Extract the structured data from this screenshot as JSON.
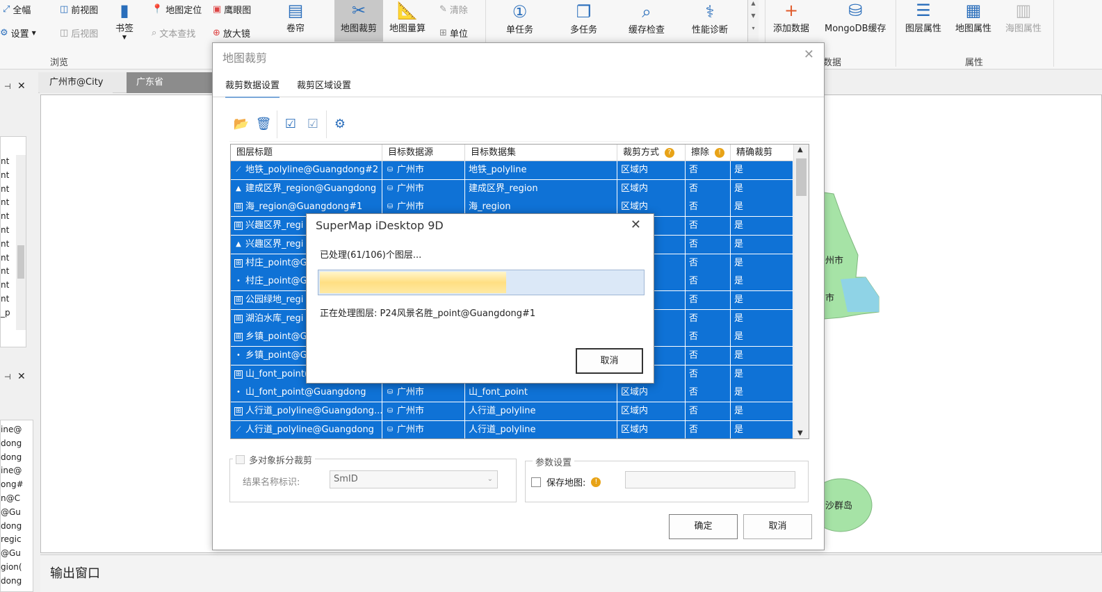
{
  "ribbon": {
    "browse": {
      "full_extent": "全幅",
      "settings": "设置",
      "prev_view": "前视图",
      "next_view": "后视图",
      "bookmark": "书签",
      "locate": "地图定位",
      "text_search": "文本查找",
      "eagle_eye": "鹰眼图",
      "magnifier": "放大镜",
      "group": "浏览"
    },
    "swipe": "卷帘",
    "clip": "地图裁剪",
    "measure": "地图量算",
    "clear": "清除",
    "unit": "单位",
    "tasks": {
      "single": "单任务",
      "multi": "多任务",
      "cache_check": "缓存检查",
      "diagnosis": "性能诊断"
    },
    "data": {
      "add": "添加数据",
      "mongo": "MongoDB缓存",
      "group": "数据"
    },
    "props": {
      "layer": "图层属性",
      "map": "地图属性",
      "chart": "海图属性",
      "group": "属性"
    }
  },
  "map_tabs": [
    "广州市@City",
    "广东省@Guangdong"
  ],
  "left_panel": {
    "items_top": [
      "nt",
      "nt",
      "nt",
      "nt",
      "nt",
      "nt",
      "nt",
      "nt",
      "nt",
      "nt",
      "nt",
      "_p"
    ],
    "items_bottom": [
      "ine@",
      "dong",
      "dong",
      "ine@",
      "ong#",
      "n@C",
      "@Gu",
      "dong",
      "regic",
      "@Gu",
      "gion(",
      "dong"
    ]
  },
  "map_labels": {
    "city": "州市",
    "city2": "市",
    "island": "沙群岛"
  },
  "output": {
    "title": "输出窗口"
  },
  "dialog": {
    "title": "地图裁剪",
    "tabs": [
      "裁剪数据设置",
      "裁剪区域设置"
    ],
    "columns": [
      "图层标题",
      "目标数据源",
      "目标数据集",
      "裁剪方式",
      "擦除",
      "精确裁剪"
    ],
    "rows": [
      {
        "title": "地铁_polyline@Guangdong#2",
        "src": "广州市",
        "ds": "地铁_polyline",
        "mode": "区域内",
        "erase": "否",
        "exact": "是",
        "icon": "line"
      },
      {
        "title": "建成区界_region@Guangdong",
        "src": "广州市",
        "ds": "建成区界_region",
        "mode": "区域内",
        "erase": "否",
        "exact": "是",
        "icon": "region"
      },
      {
        "title": "海_region@Guangdong#1",
        "src": "广州市",
        "ds": "海_region",
        "mode": "区域内",
        "erase": "否",
        "exact": "是",
        "icon": "theme"
      },
      {
        "title": "兴趣区界_regi",
        "src": "",
        "ds": "",
        "mode": "",
        "erase": "否",
        "exact": "是",
        "icon": "theme"
      },
      {
        "title": "兴趣区界_regi",
        "src": "",
        "ds": "",
        "mode": "",
        "erase": "否",
        "exact": "是",
        "icon": "region"
      },
      {
        "title": "村庄_point@G",
        "src": "",
        "ds": "",
        "mode": "",
        "erase": "否",
        "exact": "是",
        "icon": "theme"
      },
      {
        "title": "村庄_point@G",
        "src": "",
        "ds": "",
        "mode": "",
        "erase": "否",
        "exact": "是",
        "icon": "point"
      },
      {
        "title": "公园绿地_regi",
        "src": "",
        "ds": "",
        "mode": "",
        "erase": "否",
        "exact": "是",
        "icon": "theme"
      },
      {
        "title": "湖泊水库_regi",
        "src": "",
        "ds": "",
        "mode": "",
        "erase": "否",
        "exact": "是",
        "icon": "theme"
      },
      {
        "title": "乡镇_point@G",
        "src": "",
        "ds": "",
        "mode": "",
        "erase": "否",
        "exact": "是",
        "icon": "theme"
      },
      {
        "title": "乡镇_point@G",
        "src": "",
        "ds": "",
        "mode": "",
        "erase": "否",
        "exact": "是",
        "icon": "point"
      },
      {
        "title": "山_font_point(",
        "src": "",
        "ds": "",
        "mode": "",
        "erase": "否",
        "exact": "是",
        "icon": "theme"
      },
      {
        "title": "山_font_point@Guangdong",
        "src": "广州市",
        "ds": "山_font_point",
        "mode": "区域内",
        "erase": "否",
        "exact": "是",
        "icon": "point"
      },
      {
        "title": "人行道_polyline@Guangdong...",
        "src": "广州市",
        "ds": "人行道_polyline",
        "mode": "区域内",
        "erase": "否",
        "exact": "是",
        "icon": "theme"
      },
      {
        "title": "人行道_polyline@Guangdong",
        "src": "广州市",
        "ds": "人行道_polyline",
        "mode": "区域内",
        "erase": "否",
        "exact": "是",
        "icon": "line"
      }
    ],
    "multi_split": "多对象拆分裁剪",
    "result_label": "结果名称标识:",
    "result_value": "SmID",
    "param_group": "参数设置",
    "save_map": "保存地图:",
    "ok": "确定",
    "cancel": "取消"
  },
  "progress": {
    "title": "SuperMap iDesktop 9D",
    "processed": "已处理(61/106)个图层...",
    "fraction": 0.5755,
    "current": "正在处理图层: P24风景名胜_point@Guangdong#1",
    "cancel": "取消"
  },
  "colors": {
    "selection": "#0f72d6",
    "accent": "#2a6ebb",
    "map_green": "#a6e3a6",
    "map_cyan": "#8fd3e6"
  }
}
